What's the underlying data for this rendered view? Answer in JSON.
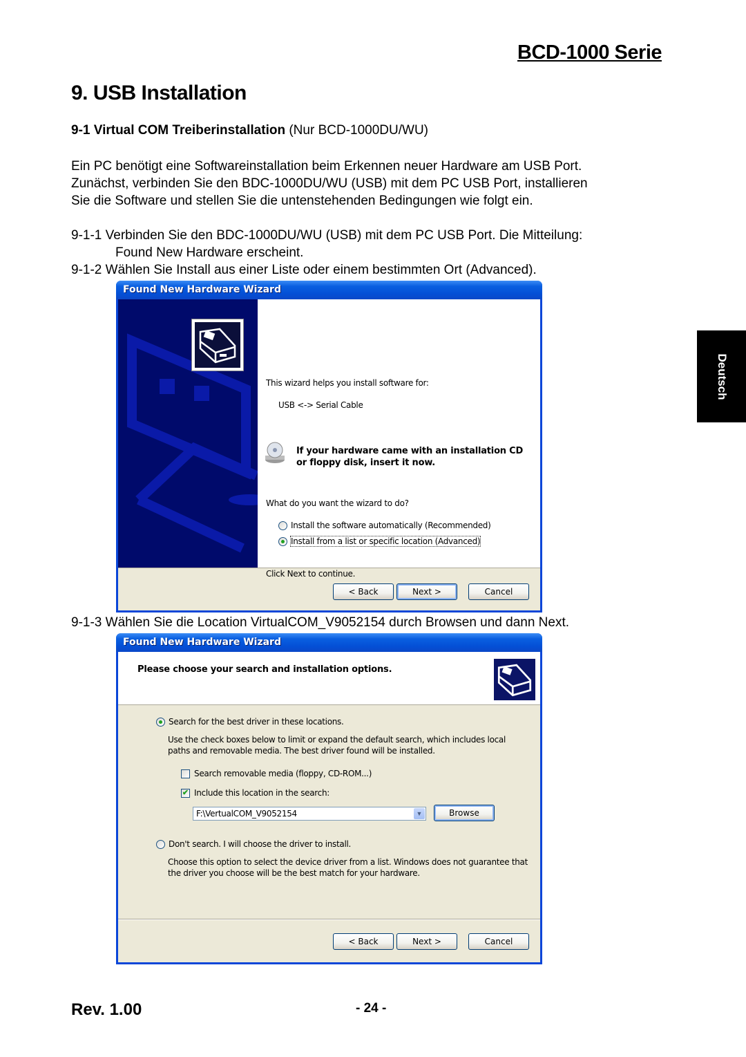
{
  "header": {
    "series": "BCD-1000 Serie",
    "chapter_title": "9. USB Installation",
    "section_number": "9-1",
    "section_title_bold": "Virtual COM Treiberinstallation",
    "section_title_normal": "(Nur BCD-1000DU/WU)"
  },
  "intro": [
    "Ein PC benötigt eine Softwareinstallation beim Erkennen neuer Hardware am USB Port.",
    "Zunächst, verbinden Sie den BDC-1000DU/WU (USB) mit dem PC USB Port, installieren",
    "Sie die Software und stellen Sie die untenstehenden Bedingungen wie folgt ein."
  ],
  "steps": [
    {
      "num": "9-1-1",
      "text": "Verbinden Sie den BDC-1000DU/WU (USB) mit dem PC USB Port. Die Mitteilung:",
      "cont": "Found New Hardware erscheint."
    },
    {
      "num": "9-1-2",
      "text": "Wählen Sie Install aus einer Liste oder einem bestimmten Ort (Advanced)."
    },
    {
      "num": "9-1-3",
      "text": "Wählen Sie die Location VirtualCOM_V9052154 durch Browsen und dann Next."
    }
  ],
  "dialog1": {
    "title": "Found New Hardware Wizard",
    "intro": "This wizard helps you install software for:",
    "device": "USB <-> Serial Cable",
    "cd_notice_line1": "If your hardware came with an installation CD",
    "cd_notice_line2": "or floppy disk, insert it now.",
    "question": "What do you want the wizard to do?",
    "options": [
      {
        "label": "Install the software automatically (Recommended)",
        "selected": false
      },
      {
        "label": "Install from a list or specific location (Advanced)",
        "selected": true
      }
    ],
    "hint": "Click Next to continue.",
    "buttons": {
      "back": "< Back",
      "next": "Next >",
      "cancel": "Cancel"
    }
  },
  "dialog2": {
    "title": "Found New Hardware Wizard",
    "heading": "Please choose your search and installation options.",
    "option_search": {
      "label": "Search for the best driver in these locations.",
      "selected": true
    },
    "search_desc_line1": "Use the check boxes below to limit or expand the default search, which includes local",
    "search_desc_line2": "paths and removable media. The best driver found will be installed.",
    "checkbox_removable": {
      "label": "Search removable media (floppy, CD-ROM...)",
      "checked": false
    },
    "checkbox_location": {
      "label": "Include this location in the search:",
      "checked": true
    },
    "location_value": "F:\\VertualCOM_V9052154",
    "browse": "Browse",
    "option_dont_search": {
      "label": "Don't search. I will choose the driver to install.",
      "selected": false
    },
    "dont_desc_line1": "Choose this option to select the device driver from a list.  Windows does not guarantee that",
    "dont_desc_line2": "the driver you choose will be the best match for your hardware.",
    "buttons": {
      "back": "< Back",
      "next": "Next >",
      "cancel": "Cancel"
    }
  },
  "side_tab": "Deutsch",
  "footer": {
    "revision": "Rev. 1.00",
    "page": "- 24 -"
  },
  "colors": {
    "xp_blue": "#0a46d8",
    "dialog_face": "#ece9d8",
    "banner": "#000a6b"
  }
}
